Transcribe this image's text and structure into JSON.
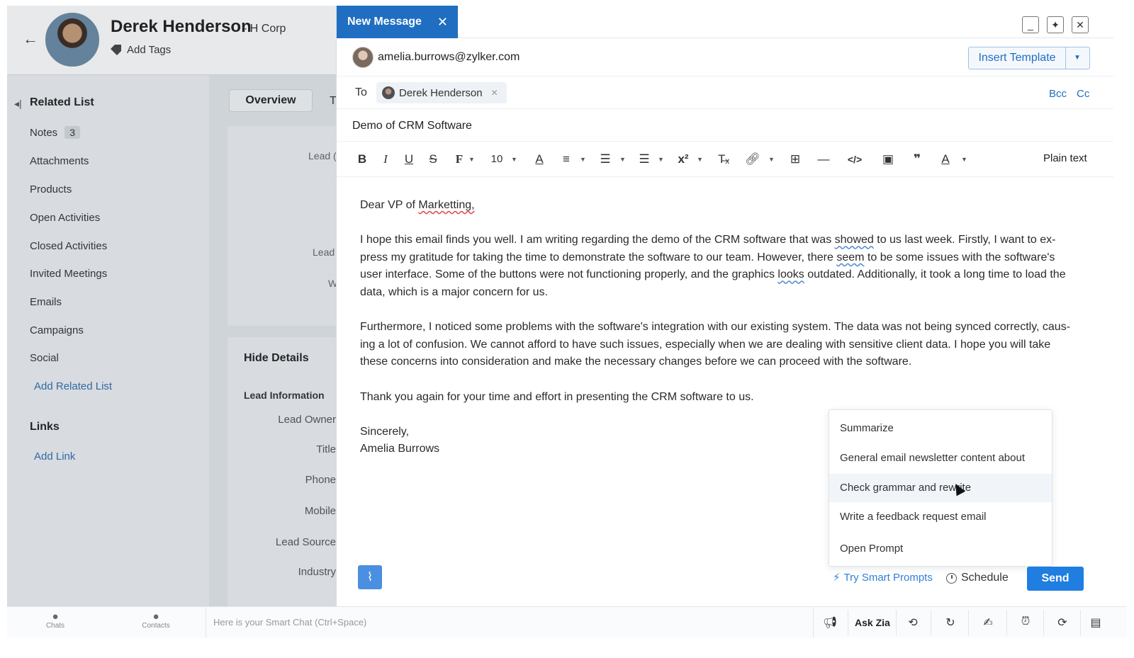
{
  "contact": {
    "name": "Derek Henderson",
    "company": "- H Corp",
    "add_tags": "Add Tags"
  },
  "related_list": {
    "title": "Related List",
    "items": [
      {
        "label": "Notes",
        "count": "3"
      },
      {
        "label": "Attachments"
      },
      {
        "label": "Products"
      },
      {
        "label": "Open Activities"
      },
      {
        "label": "Closed Activities"
      },
      {
        "label": "Invited Meetings"
      },
      {
        "label": "Emails"
      },
      {
        "label": "Campaigns"
      },
      {
        "label": "Social"
      }
    ],
    "add_related": "Add Related List",
    "links_title": "Links",
    "add_link": "Add Link"
  },
  "overview": {
    "tab": "Overview",
    "tab2_partial": "T",
    "ghost1": "Lead (",
    "ghost2": "Lead",
    "ghost3": "W",
    "hide_details": "Hide Details",
    "lead_information": "Lead Information",
    "fields": [
      "Lead Owner",
      "Title",
      "Phone",
      "Mobile",
      "Lead Source",
      "Industry"
    ]
  },
  "compose": {
    "tab_title": "New Message",
    "from_email": "amelia.burrows@zylker.com",
    "insert_template": "Insert Template",
    "to_label": "To",
    "recipient": "Derek Henderson",
    "bcc": "Bcc",
    "cc": "Cc",
    "subject": "Demo of CRM Software",
    "font_size": "10",
    "plain_text": "Plain text",
    "body": {
      "greeting_pre": "Dear VP of ",
      "greeting_word": "Marketting,",
      "p1_a": "I hope this email finds you well. I am writing regarding the demo of the CRM software that was ",
      "p1_w1": "showed",
      "p1_b": " to us last week. Firstly, I want to ex-press my gratitude for taking the time to demonstrate the software to our team. However, there ",
      "p1_w2": "seem",
      "p1_c": " to be some issues with the software's user interface.  Some of the buttons were not functioning properly, and the graphics ",
      "p1_w3": "looks",
      "p1_d": " outdated. Additionally, it took a long time to load the data, which is a major concern for us.",
      "p2": "Furthermore, I noticed some problems with the software's integration with our existing system. The data was not being synced correctly, caus-ing a lot of confusion. We cannot afford to have such issues, especially when we are dealing with sensitive client data. I hope you will take these concerns into consideration and make the necessary changes before we can proceed with the software.",
      "p3": "Thank you again for your time and effort in presenting the CRM software to us.",
      "closing": "Sincerely,",
      "signature": "Amelia Burrows"
    },
    "prompt_menu": [
      "Summarize",
      "General email newsletter content about",
      "Check grammar and rewrite",
      "Write a feedback request email",
      "Open Prompt"
    ],
    "try_smart_prompts": "Try Smart Prompts",
    "schedule": "Schedule",
    "send": "Send"
  },
  "bottom_bar": {
    "chats": "Chats",
    "contacts": "Contacts",
    "smart_chat_placeholder": "Here is your Smart Chat (Ctrl+Space)",
    "ask_zia": "Ask Zia"
  },
  "colors": {
    "accent": "#1f6ec2",
    "send": "#1f7ee0",
    "link": "#2f6fb2"
  }
}
